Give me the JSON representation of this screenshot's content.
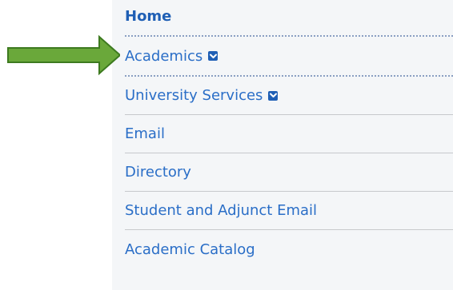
{
  "nav": {
    "items": [
      {
        "label": "Home",
        "has_dropdown": false
      },
      {
        "label": "Academics",
        "has_dropdown": true
      },
      {
        "label": "University Services",
        "has_dropdown": true
      },
      {
        "label": "Email",
        "has_dropdown": false
      },
      {
        "label": "Directory",
        "has_dropdown": false
      },
      {
        "label": "Student and Adjunct Email",
        "has_dropdown": false
      },
      {
        "label": "Academic Catalog",
        "has_dropdown": false
      }
    ]
  },
  "annotation": {
    "arrow_icon": "right-arrow-icon",
    "arrow_color": "#6aa83a",
    "arrow_outline": "#3d7a1f"
  },
  "colors": {
    "link": "#2a6ec7",
    "home": "#1f5fb5",
    "panel_bg": "#f4f6f8"
  }
}
